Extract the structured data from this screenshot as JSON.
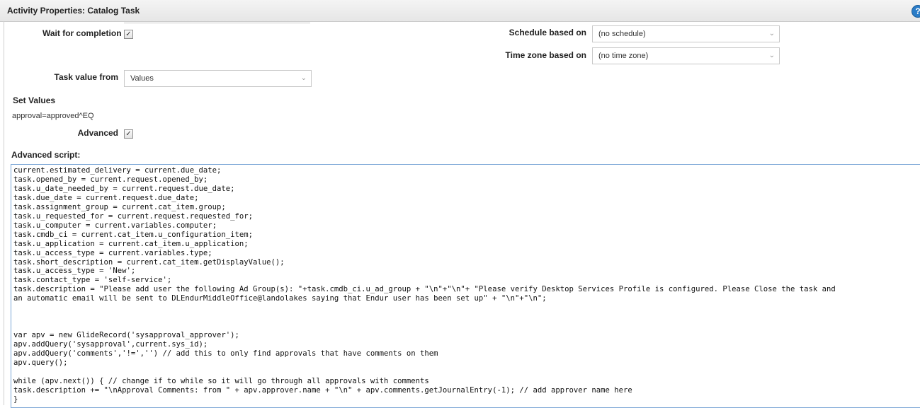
{
  "window": {
    "title": "Activity Properties: Catalog Task",
    "help_icon": "question-icon"
  },
  "form": {
    "wait_for_completion": {
      "label": "Wait for completion",
      "checked": true
    },
    "schedule_based_on": {
      "label": "Schedule based on",
      "value": "(no schedule)"
    },
    "time_zone_based_on": {
      "label": "Time zone based on",
      "value": "(no time zone)"
    },
    "task_value_from": {
      "label": "Task value from",
      "value": "Values"
    },
    "set_values": {
      "label": "Set Values",
      "value": "approval=approved^EQ"
    },
    "advanced": {
      "label": "Advanced",
      "checked": true
    },
    "advanced_script": {
      "label": "Advanced script:",
      "code": "current.estimated_delivery = current.due_date;\ntask.opened_by = current.request.opened_by;\ntask.u_date_needed_by = current.request.due_date;\ntask.due_date = current.request.due_date;\ntask.assignment_group = current.cat_item.group;\ntask.u_requested_for = current.request.requested_for;\ntask.u_computer = current.variables.computer;\ntask.cmdb_ci = current.cat_item.u_configuration_item;\ntask.u_application = current.cat_item.u_application;\ntask.u_access_type = current.variables.type;\ntask.short_description = current.cat_item.getDisplayValue();\ntask.u_access_type = 'New';\ntask.contact_type = 'self-service';\ntask.description = \"Please add user the following Ad Group(s): \"+task.cmdb_ci.u_ad_group + \"\\n\"+\"\\n\"+ \"Please verify Desktop Services Profile is configured. Please Close the task and\nan automatic email will be sent to DLEndurMiddleOffice@landolakes saying that Endur user has been set up\" + \"\\n\"+\"\\n\";\n\n\n\nvar apv = new GlideRecord('sysapproval_approver');\napv.addQuery('sysapproval',current.sys_id);\napv.addQuery('comments','!=','') // add this to only find approvals that have comments on them\napv.query();\n\nwhile (apv.next()) { // change if to while so it will go through all approvals with comments\ntask.description += \"\\nApproval Comments: from \" + apv.approver.name + \"\\n\" + apv.comments.getJournalEntry(-1); // add approver name here\n}"
    }
  },
  "glyphs": {
    "checkmark": "✓",
    "chevron": "⌄",
    "help": "?"
  }
}
